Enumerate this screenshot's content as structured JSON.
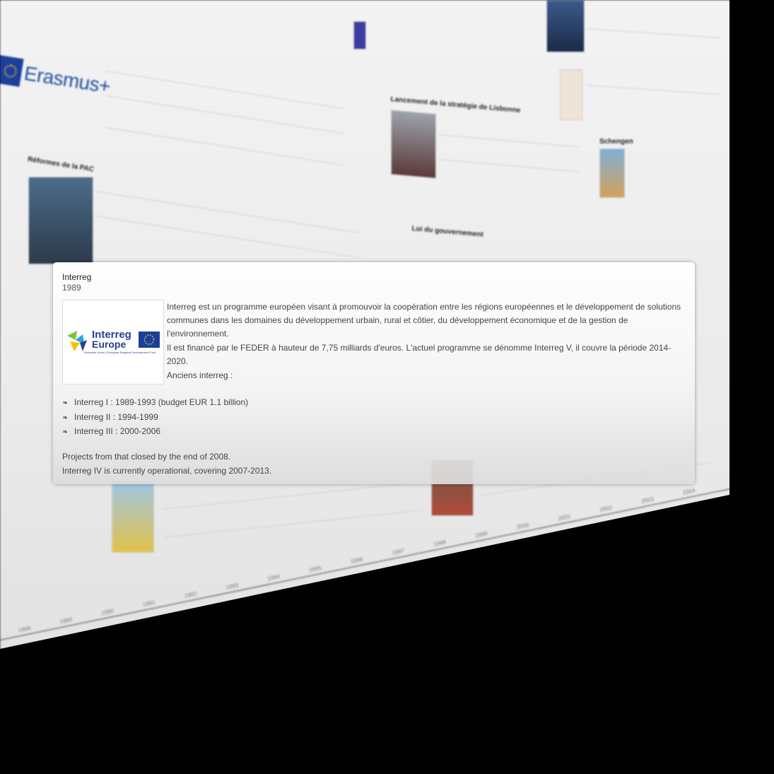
{
  "background": {
    "erasmus_word": "Erasmus+",
    "timeline_years": [
      "1988",
      "1989",
      "1990",
      "1991",
      "1992",
      "1993",
      "1994",
      "1995",
      "1996",
      "1997",
      "1998",
      "1999",
      "2000",
      "2001",
      "2002",
      "2003",
      "2004"
    ]
  },
  "popup": {
    "title": "Interreg",
    "date": "1989",
    "image_alt": "Interreg Europe",
    "logo_text_line1": "Interreg",
    "logo_text_line2": "Europe",
    "logo_caption": "European Union | European Regional Development Fund",
    "paragraph1": "Interreg est un programme européen visant à promouvoir la coopération entre les régions européennes et le développement de solutions communes dans les domaines du développement urbain, rural et côtier, du développement économique et de la gestion de l'environnement.",
    "paragraph2": "Il est financé par le FEDER à hauteur de 7,75 milliards d'euros. L'actuel programme se dénomme Interreg V, il couvre la période 2014-2020.",
    "paragraph3": "Anciens interreg :",
    "bullet_icon": "fleuron-icon",
    "bullets": [
      "Interreg I : 1989-1993 (budget EUR 1.1 billion)",
      "Interreg II : 1994-1999",
      "Interreg III : 2000-2006"
    ],
    "footer1": "Projects from that closed by the end of 2008.",
    "footer2": "Interreg IV is currently operational, covering 2007-2013."
  },
  "colors": {
    "eu_blue": "#1d3f9c",
    "eu_yellow": "#f6d21b",
    "interreg_blue": "#2b3b94"
  }
}
